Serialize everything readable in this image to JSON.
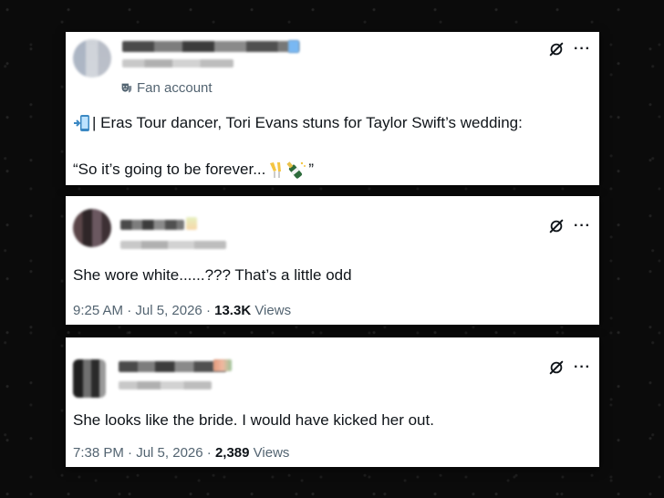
{
  "tweets": [
    {
      "badge": "Fan account",
      "text_line1": "| Eras Tour dancer, Tori Evans stuns for Taylor Swift’s wedding:",
      "text_line2_start": "“So it’s going to be forever...",
      "text_line2_end": "”",
      "icons": [
        "masks-icon",
        "mobile-arrow-icon",
        "champagne-icon",
        "grok-icon",
        "more-icon"
      ]
    },
    {
      "text": "She wore white......??? That’s a little odd",
      "time": "9:25 AM",
      "date": "Jul 5, 2026",
      "views_count": "13.3K",
      "views_label": "Views"
    },
    {
      "text": "She looks like the bride. I would have kicked her out.",
      "time": "7:38 PM",
      "date": "Jul 5, 2026",
      "views_count": "2,389",
      "views_label": "Views"
    }
  ],
  "meta_separator": "·",
  "more_glyph": "···",
  "colors": {
    "background": "#0b0b0b",
    "card": "#ffffff",
    "text": "#0f1419",
    "secondary": "#536471",
    "verified_blue": "#1d9bf0"
  }
}
